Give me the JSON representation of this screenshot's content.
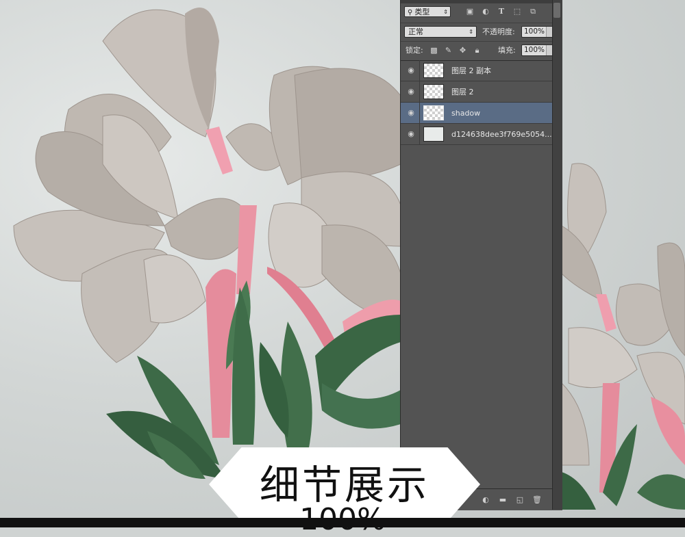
{
  "layers_panel": {
    "filter": {
      "label": "类型"
    },
    "blend": {
      "mode": "正常",
      "opacity_label": "不透明度:",
      "opacity_value": "100%"
    },
    "lock": {
      "label": "锁定:",
      "fill_label": "填充:",
      "fill_value": "100%"
    },
    "layers": [
      {
        "name": "图层 2 副本",
        "selected": false
      },
      {
        "name": "图层 2",
        "selected": false
      },
      {
        "name": "shadow",
        "selected": true
      },
      {
        "name": "d124638dee3f769e5054...",
        "selected": false
      }
    ]
  },
  "caption": {
    "title": "细节展示",
    "subtitle": "100%"
  },
  "colors": {
    "panel_bg": "#535353",
    "selected_layer": "#5a6c85",
    "petal": "#b9b3ad",
    "stem": "#e88a9a",
    "leaf": "#3f6a48"
  }
}
